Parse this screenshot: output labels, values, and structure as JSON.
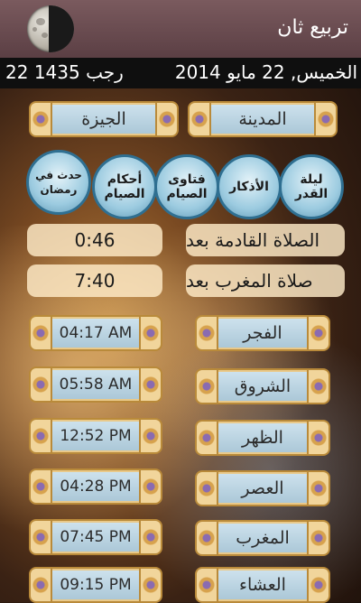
{
  "header": {
    "title": "تربيع ثان",
    "moon_icon": "moon-phase-icon"
  },
  "datebar": {
    "hijri": "22 رجب 1435",
    "gregorian": "الخميس, 22 مايو 2014"
  },
  "location": {
    "city_label": "المدينة",
    "city_value": "الجيزة"
  },
  "categories": [
    {
      "label": "ليلة\nالقدر"
    },
    {
      "label": "الأذكار"
    },
    {
      "label": "فتاوى\nالصيام"
    },
    {
      "label": "أحكام\nالصيام"
    },
    {
      "label": "حدث في\nرمضان"
    }
  ],
  "countdown": {
    "next_prayer_label": "الصلاة القادمة بعد",
    "next_prayer_value": "0:46",
    "maghrib_label": "صلاة المغرب بعد",
    "maghrib_value": "7:40"
  },
  "prayers": [
    {
      "name": "الفجر",
      "time": "04:17 AM"
    },
    {
      "name": "الشروق",
      "time": "05:58 AM"
    },
    {
      "name": "الظهر",
      "time": "12:52 PM"
    },
    {
      "name": "العصر",
      "time": "04:28 PM"
    },
    {
      "name": "المغرب",
      "time": "07:45 PM"
    },
    {
      "name": "العشاء",
      "time": "09:15 PM"
    }
  ],
  "colors": {
    "topbar": "#6b4d52",
    "datebar": "#0f0f0f",
    "ornate_fill": "#bcd5e2",
    "ornate_border": "#b98a3a",
    "round_border": "#2f6f91"
  }
}
